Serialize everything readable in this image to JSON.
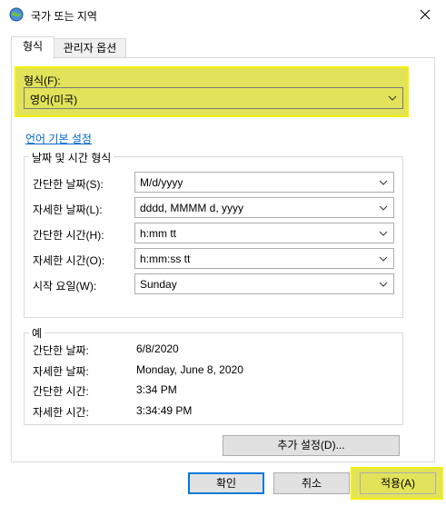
{
  "window": {
    "title": "국가 또는 지역",
    "icon": "globe-icon",
    "close_icon": "close-icon"
  },
  "tabs": [
    {
      "label": "형식",
      "active": true
    },
    {
      "label": "관리자 옵션",
      "active": false
    }
  ],
  "format": {
    "label": "형식(F):",
    "value": "영어(미국)"
  },
  "language_link": "언어 기본 설정",
  "datetime_group": {
    "title": "날짜 및 시간 형식",
    "rows": [
      {
        "label": "간단한 날짜(S):",
        "value": "M/d/yyyy"
      },
      {
        "label": "자세한 날짜(L):",
        "value": "dddd, MMMM d, yyyy"
      },
      {
        "label": "간단한 시간(H):",
        "value": "h:mm tt"
      },
      {
        "label": "자세한 시간(O):",
        "value": "h:mm:ss tt"
      },
      {
        "label": "시작 요일(W):",
        "value": "Sunday"
      }
    ]
  },
  "example_group": {
    "title": "예",
    "rows": [
      {
        "label": "간단한 날짜:",
        "value": "6/8/2020"
      },
      {
        "label": "자세한 날짜:",
        "value": "Monday, June 8, 2020"
      },
      {
        "label": "간단한 시간:",
        "value": "3:34 PM"
      },
      {
        "label": "자세한 시간:",
        "value": "3:34:49 PM"
      }
    ]
  },
  "additional_settings_label": "추가 설정(D)...",
  "buttons": {
    "ok": "확인",
    "cancel": "취소",
    "apply": "적용(A)"
  },
  "colors": {
    "highlight": "#e2e35a",
    "highlight_border": "#f5f000",
    "link": "#0066cc",
    "focus": "#0078d7"
  }
}
